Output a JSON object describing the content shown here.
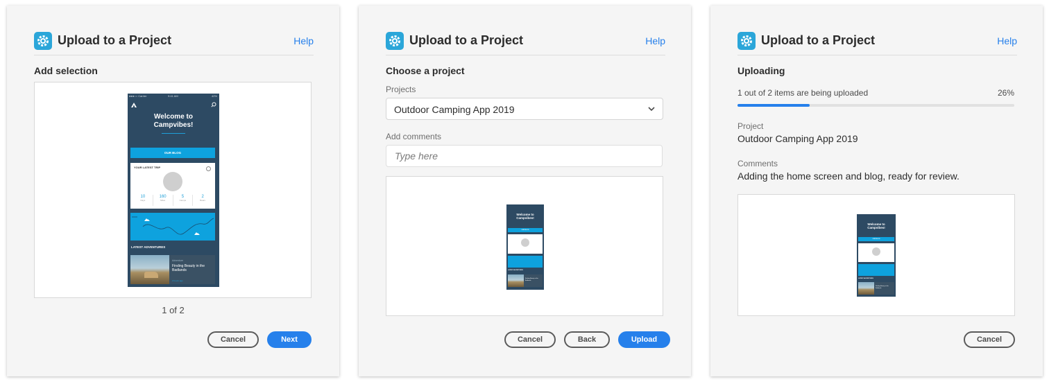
{
  "common": {
    "dialog_title": "Upload to a Project",
    "help_label": "Help",
    "cancel_label": "Cancel",
    "accent_color": "#2680eb",
    "logo_icon": "gear-logo-icon"
  },
  "step1": {
    "section_title": "Add selection",
    "pager": "1 of 2",
    "next_label": "Next"
  },
  "step2": {
    "section_title": "Choose a project",
    "projects_label": "Projects",
    "selected_project": "Outdoor Camping App 2019",
    "comments_label": "Add comments",
    "comments_placeholder": "Type here",
    "back_label": "Back",
    "upload_label": "Upload"
  },
  "step3": {
    "section_title": "Uploading",
    "progress_text": "1 out of 2 items are being uploaded",
    "progress_percent_label": "26%",
    "progress_value": 0.26,
    "project_label": "Project",
    "project_value": "Outdoor Camping App 2019",
    "comments_label": "Comments",
    "comments_value": "Adding the home screen and blog, ready for review."
  },
  "mockup": {
    "carrier": "●●●○○ Carrier",
    "time": "9:41 AM",
    "battery": "42%",
    "welcome_line1": "Welcome to",
    "welcome_line2": "Campvibes!",
    "blog_button": "OUR BLOG",
    "latest_trip": "YOUR LATEST TRIP",
    "stats": [
      {
        "value": "10",
        "label": "Days"
      },
      {
        "value": "160",
        "label": "Miles"
      },
      {
        "value": "5",
        "label": "Camps"
      },
      {
        "value": "2",
        "label": "Bears"
      }
    ],
    "latest_adventures": "LATEST ADVENTURES",
    "adventure_tag": "Adventure",
    "adventure_title": "Finding Beauty in the Badlands",
    "adventure_time": "2 hours ago"
  }
}
